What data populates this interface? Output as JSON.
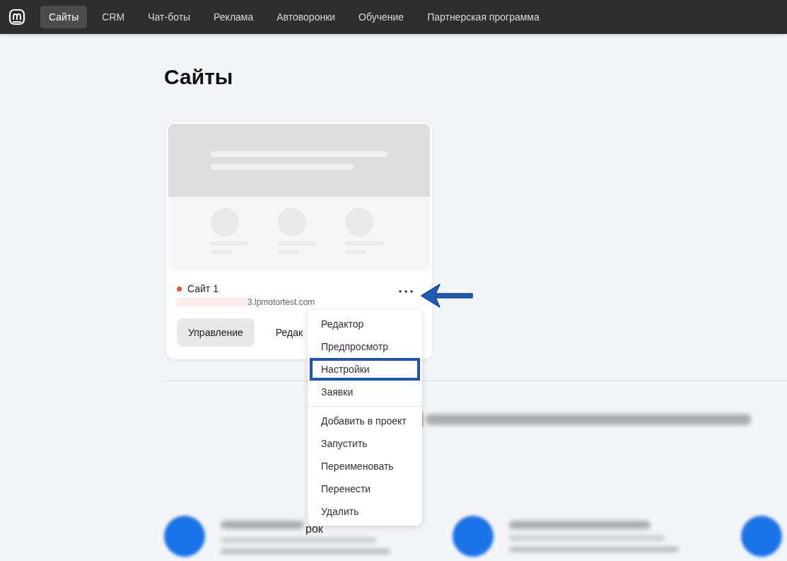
{
  "nav": {
    "tabs": [
      {
        "label": "Сайты",
        "selected": true
      },
      {
        "label": "CRM",
        "selected": false
      },
      {
        "label": "Чат-боты",
        "selected": false
      },
      {
        "label": "Реклама",
        "selected": false
      },
      {
        "label": "Автоворонки",
        "selected": false
      },
      {
        "label": "Обучение",
        "selected": false
      },
      {
        "label": "Партнерская программа",
        "selected": false
      }
    ]
  },
  "page": {
    "title": "Сайты"
  },
  "site": {
    "name": "Сайт 1",
    "published": false,
    "domain": "3.lpmotortest.com",
    "buttons": [
      "Управление",
      "Редак"
    ]
  },
  "menu": {
    "groups": [
      [
        {
          "label": "Редактор",
          "highlighted": false
        },
        {
          "label": "Предпросмотр",
          "highlighted": false
        },
        {
          "label": "Настройки",
          "highlighted": true
        },
        {
          "label": "Заявки",
          "highlighted": false
        }
      ],
      [
        {
          "label": "Добавить в проект",
          "highlighted": false
        },
        {
          "label": "Запустить",
          "highlighted": false
        },
        {
          "label": "Переименовать",
          "highlighted": false
        },
        {
          "label": "Перенести",
          "highlighted": false
        },
        {
          "label": "Удалить",
          "highlighted": false
        }
      ]
    ]
  },
  "promo": {
    "feature_fragment": "рок"
  }
}
